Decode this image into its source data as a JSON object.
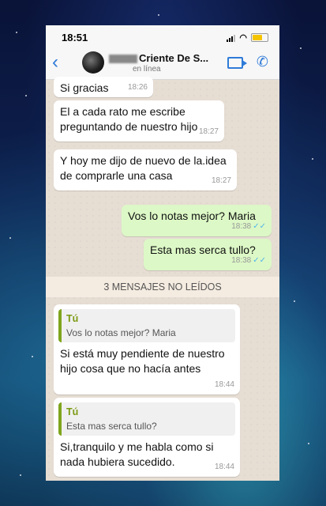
{
  "status_bar": {
    "time": "18:51"
  },
  "header": {
    "contact_name": "Criente De S...",
    "status": "en línea"
  },
  "messages": [
    {
      "text": "Si gracias",
      "time": "18:26"
    },
    {
      "text": "El a cada rato me escribe preguntando de nuestro hijo",
      "time": "18:27"
    },
    {
      "text": "Y hoy me dijo de nuevo de la.idea de comprarle una casa",
      "time": "18:27"
    },
    {
      "text": "Vos lo notas mejor? Maria",
      "time": "18:38"
    },
    {
      "text": "Esta mas serca tullo?",
      "time": "18:38"
    },
    {
      "text": "Si está muy pendiente de nuestro hijo cosa que no hacía antes",
      "time": "18:44",
      "quote_author": "Tú",
      "quote_text": "Vos lo notas mejor? Maria"
    },
    {
      "text": "Si,tranquilo y me habla como si nada hubiera sucedido.",
      "time": "18:44",
      "quote_author": "Tú",
      "quote_text": "Esta mas serca tullo?"
    }
  ],
  "unread_banner": "3 MENSAJES NO LEÍDOS",
  "colors": {
    "accent": "#2f7bd8",
    "outgoing_bubble": "#dcf8c6",
    "incoming_bubble": "#ffffff",
    "read_ticks": "#4fb6ec"
  }
}
